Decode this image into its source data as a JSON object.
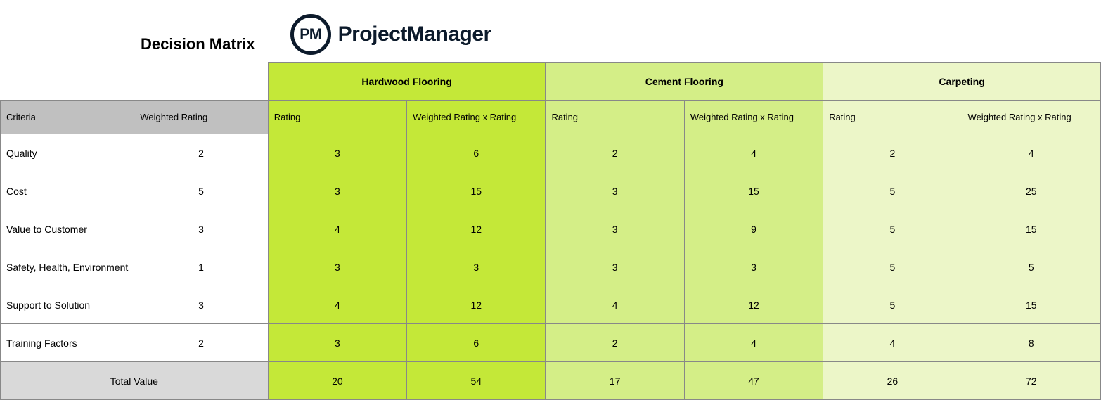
{
  "brand": {
    "abbrev": "PM",
    "name": "ProjectManager"
  },
  "title": "Decision Matrix",
  "headers": {
    "criteria": "Criteria",
    "weighted": "Weighted Rating",
    "rating": "Rating",
    "wxr": "Weighted Rating x Rating",
    "total": "Total Value"
  },
  "options": [
    {
      "name": "Hardwood Flooring",
      "shade": "g1",
      "totals": {
        "rating": 20,
        "wxr": 54
      }
    },
    {
      "name": "Cement Flooring",
      "shade": "g2",
      "totals": {
        "rating": 17,
        "wxr": 47
      }
    },
    {
      "name": "Carpeting",
      "shade": "g3",
      "totals": {
        "rating": 26,
        "wxr": 72
      }
    }
  ],
  "criteria": [
    {
      "label": "Quality",
      "weight": 2,
      "cells": [
        {
          "r": 3,
          "w": 6
        },
        {
          "r": 2,
          "w": 4
        },
        {
          "r": 2,
          "w": 4
        }
      ]
    },
    {
      "label": "Cost",
      "weight": 5,
      "cells": [
        {
          "r": 3,
          "w": 15
        },
        {
          "r": 3,
          "w": 15
        },
        {
          "r": 5,
          "w": 25
        }
      ]
    },
    {
      "label": "Value to Customer",
      "weight": 3,
      "cells": [
        {
          "r": 4,
          "w": 12
        },
        {
          "r": 3,
          "w": 9
        },
        {
          "r": 5,
          "w": 15
        }
      ]
    },
    {
      "label": "Safety, Health, Environment",
      "weight": 1,
      "cells": [
        {
          "r": 3,
          "w": 3
        },
        {
          "r": 3,
          "w": 3
        },
        {
          "r": 5,
          "w": 5
        }
      ]
    },
    {
      "label": "Support to Solution",
      "weight": 3,
      "cells": [
        {
          "r": 4,
          "w": 12
        },
        {
          "r": 4,
          "w": 12
        },
        {
          "r": 5,
          "w": 15
        }
      ]
    },
    {
      "label": "Training Factors",
      "weight": 2,
      "cells": [
        {
          "r": 3,
          "w": 6
        },
        {
          "r": 2,
          "w": 4
        },
        {
          "r": 4,
          "w": 8
        }
      ]
    }
  ]
}
